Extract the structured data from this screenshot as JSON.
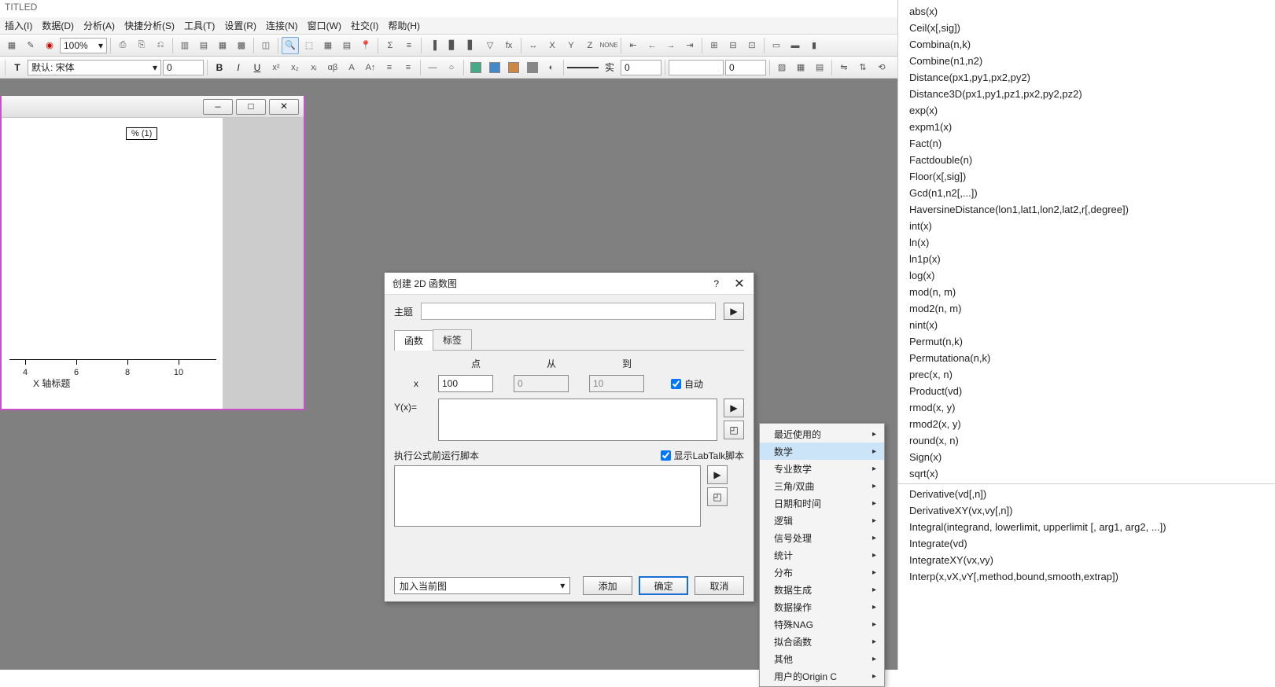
{
  "window_title": "TITLED",
  "menu": [
    "插入(I)",
    "数据(D)",
    "分析(A)",
    "快捷分析(S)",
    "工具(T)",
    "设置(R)",
    "连接(N)",
    "窗口(W)",
    "社交(I)",
    "帮助(H)"
  ],
  "toolbar": {
    "zoom": "100%",
    "font_label": "默认: 宋体",
    "size_box": "0",
    "num1": "0",
    "num2": "0",
    "line_style": "实"
  },
  "graph": {
    "legend": "% (1)",
    "axis_title": "X 轴标题",
    "ticks": [
      "4",
      "6",
      "8",
      "10"
    ]
  },
  "dialog": {
    "title": "创建 2D 函数图",
    "help": "?",
    "close": "✕",
    "theme_label": "主题",
    "tabs": [
      "函数",
      "标签"
    ],
    "hdr": [
      "点",
      "从",
      "到"
    ],
    "x_label": "x",
    "x_points": "100",
    "x_from": "0",
    "x_to": "10",
    "auto": "自动",
    "yx_label": "Y(x)=",
    "script_label": "执行公式前运行脚本",
    "show_labtalk": "显示LabTalk脚本",
    "dropdown": "加入当前图",
    "btn_add": "添加",
    "btn_ok": "确定",
    "btn_cancel": "取消"
  },
  "context_menu": [
    "最近使用的",
    "数学",
    "专业数学",
    "三角/双曲",
    "日期和时间",
    "逻辑",
    "信号处理",
    "统计",
    "分布",
    "数据生成",
    "数据操作",
    "特殊NAG",
    "拟合函数",
    "其他",
    "用户的Origin C"
  ],
  "context_hl_index": 1,
  "functions_main": [
    "abs(x)",
    "Ceil(x[,sig])",
    "Combina(n,k)",
    "Combine(n1,n2)",
    "Distance(px1,py1,px2,py2)",
    "Distance3D(px1,py1,pz1,px2,py2,pz2)",
    "exp(x)",
    "expm1(x)",
    "Fact(n)",
    "Factdouble(n)",
    "Floor(x[,sig])",
    "Gcd(n1,n2[,...])",
    "HaversineDistance(lon1,lat1,lon2,lat2,r[,degree])",
    "int(x)",
    "ln(x)",
    "ln1p(x)",
    "log(x)",
    "mod(n, m)",
    "mod2(n, m)",
    "nint(x)",
    "Permut(n,k)",
    "Permutationa(n,k)",
    "prec(x, n)",
    "Product(vd)",
    "rmod(x, y)",
    "rmod2(x, y)",
    "round(x, n)",
    "Sign(x)",
    "sqrt(x)"
  ],
  "functions_extra": [
    "Derivative(vd[,n])",
    "DerivativeXY(vx,vy[,n])",
    "Integral(integrand, lowerlimit, upperlimit [, arg1, arg2, ...])",
    "Integrate(vd)",
    "IntegrateXY(vx,vy)",
    "Interp(x,vX,vY[,method,bound,smooth,extrap])"
  ]
}
